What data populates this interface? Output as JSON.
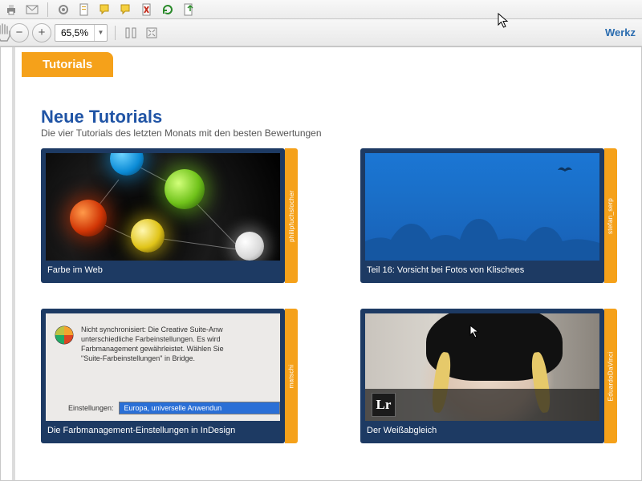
{
  "toolbar": {
    "zoom_value": "65,5%",
    "right_link": "Werkz"
  },
  "page": {
    "tab_label": "Tutorials",
    "section_title": "Neue Tutorials",
    "section_sub": "Die vier Tutorials des letzten Monats mit den besten Bewertungen"
  },
  "cards": [
    {
      "title": "Farbe im Web",
      "author": "philipfuchslocher"
    },
    {
      "title": "Teil 16: Vorsicht bei Fotos von Klischees",
      "author": "stefan_serp"
    },
    {
      "title": "Die Farbmanagement-Einstellungen in InDesign",
      "author": "matschi"
    },
    {
      "title": "Der Weißabgleich",
      "author": "EduardoDaVinci"
    }
  ],
  "card3_dialog": {
    "line1": "Nicht synchronisiert: Die Creative Suite-Anw",
    "line2": "unterschiedliche Farbeinstellungen. Es wird",
    "line3": "Farbmanagement gewährleistet. Wählen Sie",
    "line4": "\"Suite-Farbeinstellungen\" in Bridge.",
    "field_label": "Einstellungen:",
    "field_value": "Europa, universelle Anwendun"
  },
  "card4": {
    "lr_label": "Lr"
  }
}
